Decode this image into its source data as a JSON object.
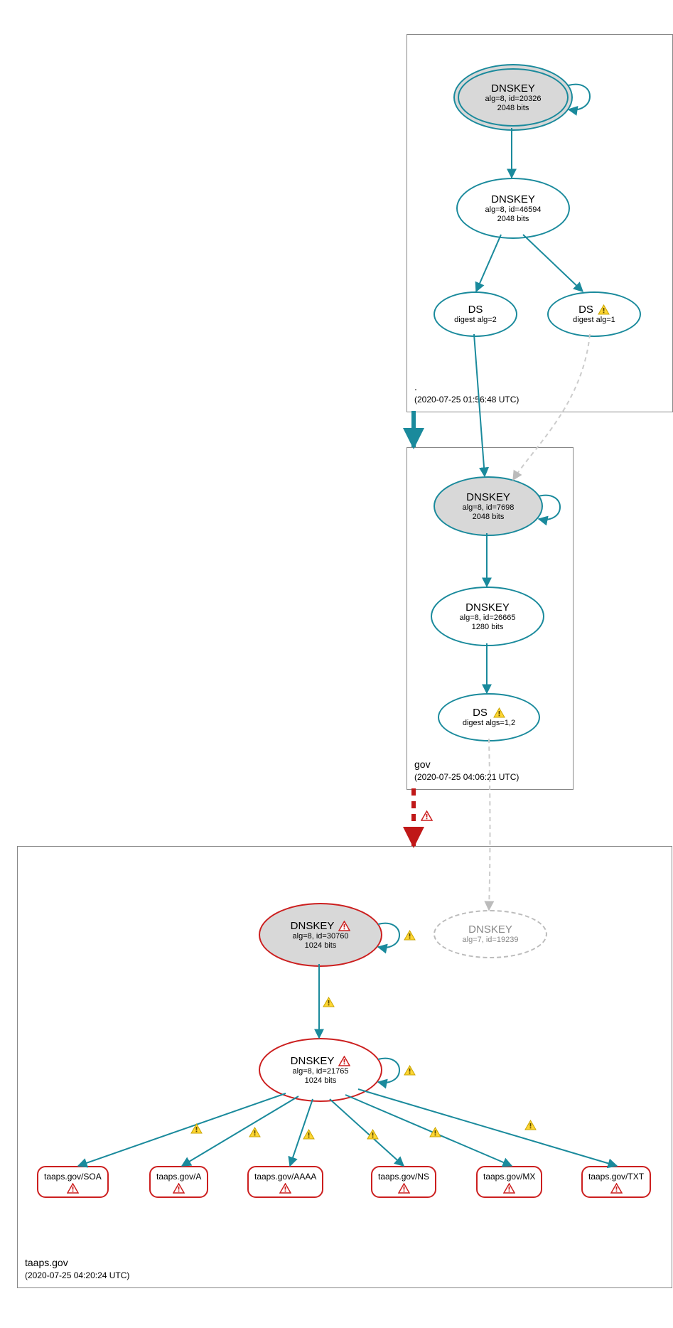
{
  "zones": {
    "root": {
      "label": ".",
      "timestamp": "(2020-07-25 01:56:48 UTC)"
    },
    "gov": {
      "label": "gov",
      "timestamp": "(2020-07-25 04:06:21 UTC)"
    },
    "taaps": {
      "label": "taaps.gov",
      "timestamp": "(2020-07-25 04:20:24 UTC)"
    }
  },
  "nodes": {
    "root_ksk": {
      "title": "DNSKEY",
      "sub1": "alg=8, id=20326",
      "sub2": "2048 bits"
    },
    "root_zsk": {
      "title": "DNSKEY",
      "sub1": "alg=8, id=46594",
      "sub2": "2048 bits"
    },
    "root_ds1": {
      "title": "DS",
      "sub1": "digest alg=2"
    },
    "root_ds2": {
      "title": "DS",
      "sub1": "digest alg=1"
    },
    "gov_ksk": {
      "title": "DNSKEY",
      "sub1": "alg=8, id=7698",
      "sub2": "2048 bits"
    },
    "gov_zsk": {
      "title": "DNSKEY",
      "sub1": "alg=8, id=26665",
      "sub2": "1280 bits"
    },
    "gov_ds": {
      "title": "DS",
      "sub1": "digest algs=1,2"
    },
    "taaps_ksk": {
      "title": "DNSKEY",
      "sub1": "alg=8, id=30760",
      "sub2": "1024 bits"
    },
    "taaps_zsk": {
      "title": "DNSKEY",
      "sub1": "alg=8, id=21765",
      "sub2": "1024 bits"
    },
    "taaps_ext": {
      "title": "DNSKEY",
      "sub1": "alg=7, id=19239"
    }
  },
  "rr": {
    "soa": "taaps.gov/SOA",
    "a": "taaps.gov/A",
    "aaaa": "taaps.gov/AAAA",
    "ns": "taaps.gov/NS",
    "mx": "taaps.gov/MX",
    "txt": "taaps.gov/TXT"
  }
}
